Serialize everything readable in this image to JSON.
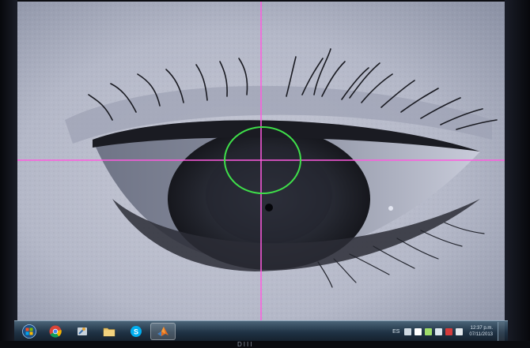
{
  "viewer": {
    "crosshair_color": "#ff5ae0",
    "pupil_circle_color": "#3fe04a"
  },
  "taskbar": {
    "buttons": [
      {
        "name": "start-button",
        "icon": "windows-logo-icon",
        "active": false
      },
      {
        "name": "chrome-button",
        "icon": "chrome-icon",
        "active": false
      },
      {
        "name": "tools-button",
        "icon": "tools-icon",
        "active": false
      },
      {
        "name": "folder-button",
        "icon": "folder-icon",
        "active": false
      },
      {
        "name": "skype-button",
        "icon": "skype-icon",
        "active": false
      },
      {
        "name": "matlab-button",
        "icon": "matlab-icon",
        "active": true
      }
    ],
    "tray": {
      "language": "ES",
      "time": "12:37 p.m.",
      "date": "07/11/2013"
    }
  },
  "partial_caption": "DIII"
}
